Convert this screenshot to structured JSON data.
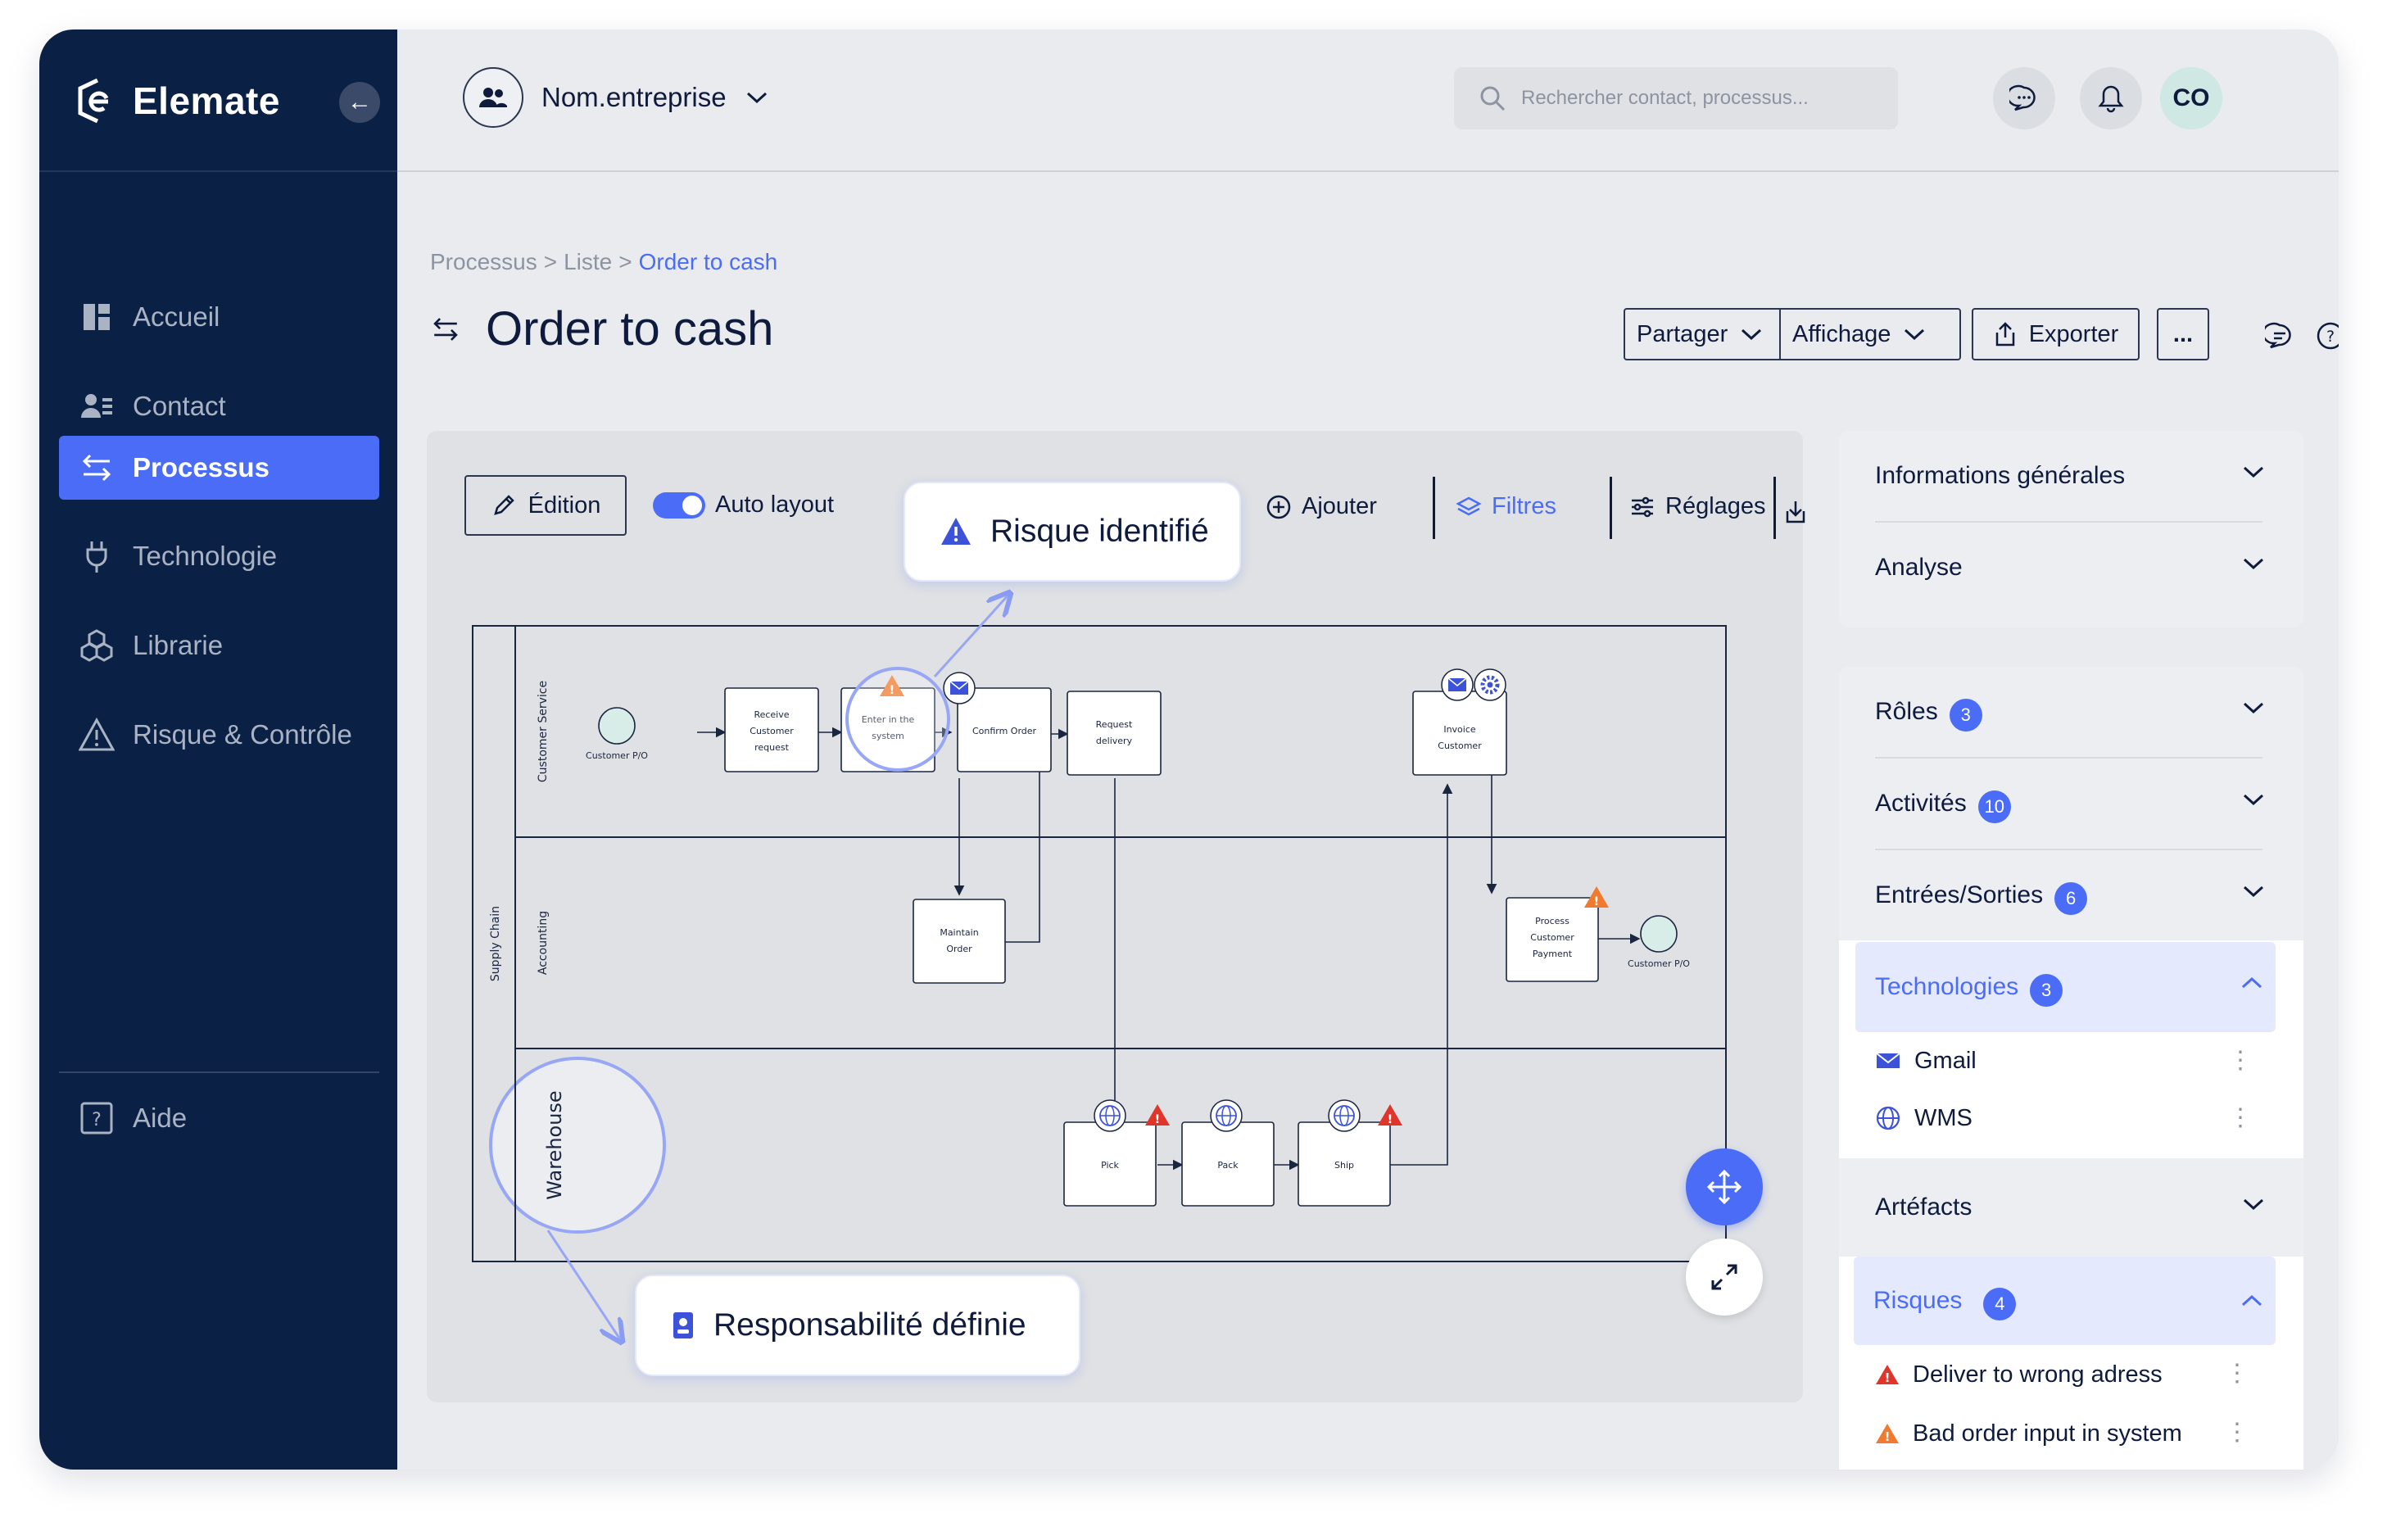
{
  "brand": {
    "name": "Elemate"
  },
  "sidebar": {
    "items": [
      {
        "label": "Accueil"
      },
      {
        "label": "Contact"
      },
      {
        "label": "Processus"
      },
      {
        "label": "Technologie"
      },
      {
        "label": "Librarie"
      },
      {
        "label": "Risque & Contrôle"
      }
    ],
    "help": "Aide"
  },
  "topbar": {
    "org": "Nom.entreprise",
    "search_placeholder": "Rechercher contact, processus...",
    "avatar": "CO"
  },
  "breadcrumb": {
    "items": [
      "Processus",
      "Liste"
    ],
    "current": "Order to cash",
    "sep": ">"
  },
  "page": {
    "title": "Order to cash"
  },
  "header_actions": {
    "share": "Partager",
    "display": "Affichage",
    "export": "Exporter",
    "more": "..."
  },
  "canvas": {
    "edit": "Édition",
    "auto_layout": "Auto layout",
    "auto_layout_on": true,
    "add": "Ajouter",
    "filters": "Filtres",
    "settings": "Réglages",
    "callout_risk": "Risque identifié",
    "callout_role": "Responsabilité définie"
  },
  "diagram": {
    "pool": "Supply Chain",
    "lanes": [
      "Customer Service",
      "Accounting",
      "Warehouse"
    ],
    "start_event": "Customer P/O",
    "end_event": "Customer P/O",
    "tasks": {
      "receive": [
        "Receive",
        "Customer",
        "request"
      ],
      "enter": [
        "Enter in the",
        "system"
      ],
      "confirm": [
        "Confirm Order"
      ],
      "request": [
        "Request",
        "delivery"
      ],
      "invoice": [
        "Invoice",
        "Customer"
      ],
      "maintain": [
        "Maintain",
        "Order"
      ],
      "payment": [
        "Process",
        "Customer",
        "Payment"
      ],
      "pick": [
        "Pick"
      ],
      "pack": [
        "Pack"
      ],
      "ship": [
        "Ship"
      ]
    }
  },
  "right_panel": {
    "general": {
      "label": "Informations générales"
    },
    "analysis": {
      "label": "Analyse"
    },
    "roles": {
      "label": "Rôles",
      "count": "3"
    },
    "activities": {
      "label": "Activités",
      "count": "10"
    },
    "io": {
      "label": "Entrées/Sorties",
      "count": "6"
    },
    "technologies": {
      "label": "Technologies",
      "count": "3",
      "items": [
        {
          "label": "Gmail"
        },
        {
          "label": "WMS"
        }
      ]
    },
    "artifacts": {
      "label": "Artéfacts"
    },
    "risks": {
      "label": "Risques",
      "count": "4",
      "items": [
        {
          "label": "Deliver to wrong adress",
          "color": "#e0352b"
        },
        {
          "label": "Bad order input in system",
          "color": "#f07a2e"
        }
      ]
    }
  },
  "colors": {
    "navy": "#0a2145",
    "accent": "#4a6cf7",
    "risk_red": "#e0352b",
    "risk_orange": "#f07a2e"
  }
}
